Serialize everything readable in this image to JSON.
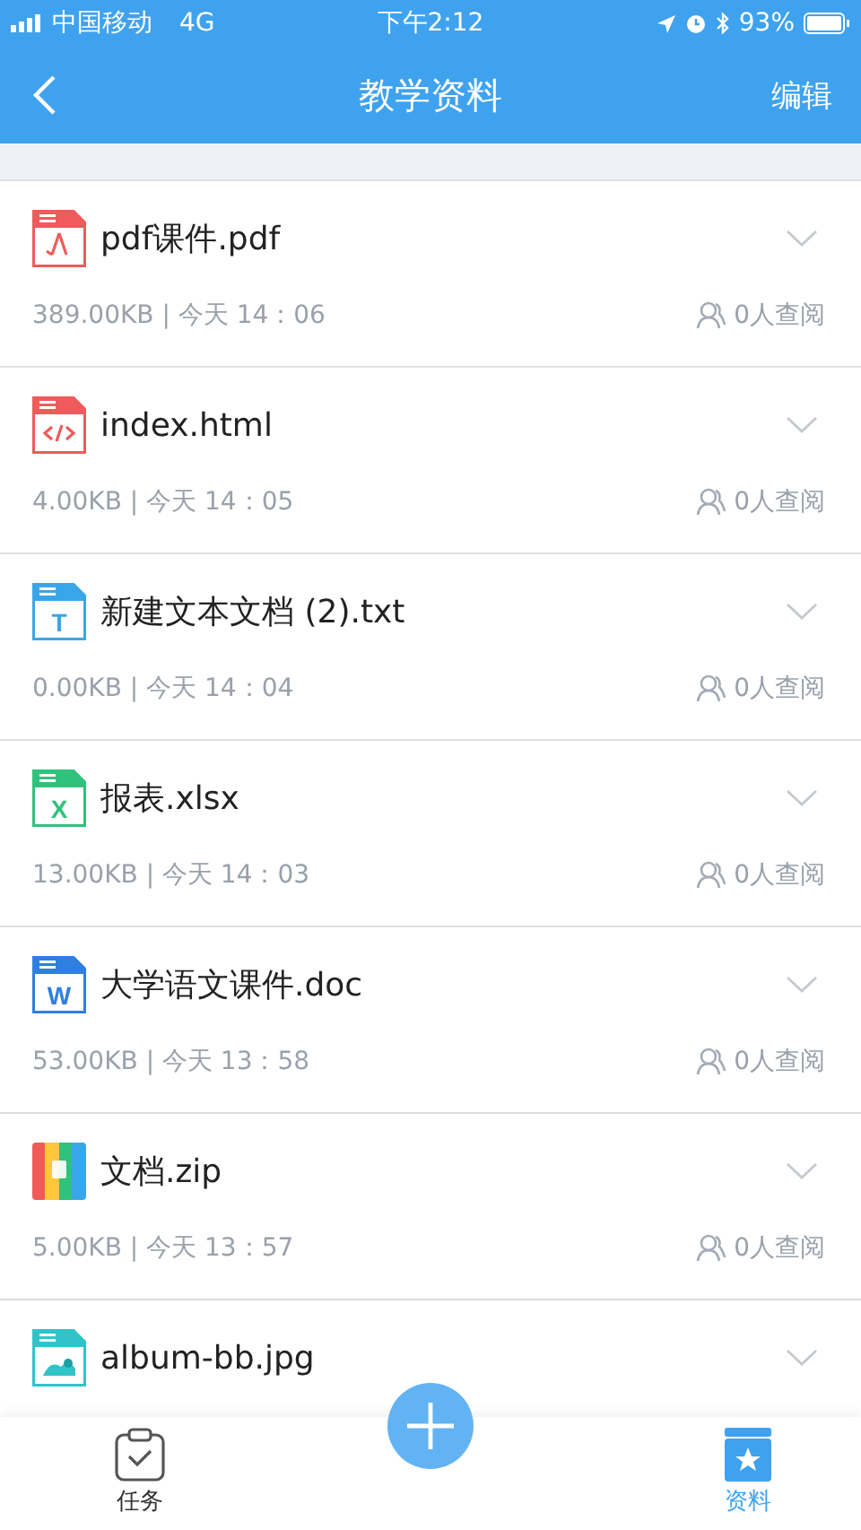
{
  "status_bar": {
    "carrier": "中国移动",
    "network": "4G",
    "time": "下午2:12",
    "battery": "93%"
  },
  "nav": {
    "title": "教学资料",
    "action": "编辑"
  },
  "files": [
    {
      "kind": "pdf",
      "name": "pdf课件.pdf",
      "meta": "389.00KB | 今天 14：06",
      "views": "0人查阅"
    },
    {
      "kind": "html",
      "name": "index.html",
      "meta": "4.00KB | 今天 14：05",
      "views": "0人查阅"
    },
    {
      "kind": "txt",
      "icon_letter": "T",
      "name": "新建文本文档 (2).txt",
      "meta": "0.00KB | 今天 14：04",
      "views": "0人查阅"
    },
    {
      "kind": "xlsx",
      "icon_letter": "X",
      "name": "报表.xlsx",
      "meta": "13.00KB | 今天 14：03",
      "views": "0人查阅"
    },
    {
      "kind": "doc",
      "icon_letter": "W",
      "name": "大学语文课件.doc",
      "meta": "53.00KB | 今天 13：58",
      "views": "0人查阅"
    },
    {
      "kind": "zip",
      "name": "文档.zip",
      "meta": "5.00KB | 今天 13：57",
      "views": "0人查阅"
    },
    {
      "kind": "jpg",
      "name": "album-bb.jpg"
    }
  ],
  "tabs": [
    {
      "label": "任务",
      "kind": "task",
      "selected": false
    },
    {
      "label": "资料",
      "kind": "docs",
      "selected": true
    }
  ]
}
